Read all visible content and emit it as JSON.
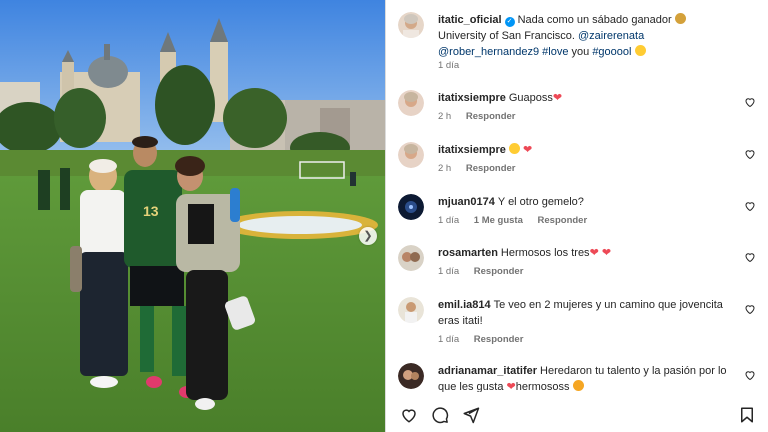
{
  "post": {
    "username": "itatic_oficial",
    "caption": {
      "part1": "Nada como un sábado ganador",
      "part2": "University of San Francisco.",
      "mention1": "@zairerenata",
      "mention2": "@rober_hernandez9",
      "hashtag1": "#love",
      "word_you": "you",
      "hashtag2": "#gooool"
    },
    "time": "1 día"
  },
  "comments": [
    {
      "username": "itatixsiempre",
      "text": "Guaposs",
      "time": "2 h",
      "reply": "Responder",
      "emojis": [
        "heart"
      ]
    },
    {
      "username": "itatixsiempre",
      "text": "",
      "time": "2 h",
      "reply": "Responder",
      "emojis": [
        "smiley",
        "heart"
      ]
    },
    {
      "username": "mjuan0174",
      "text": "Y el otro gemelo?",
      "time": "1 día",
      "likes": "1 Me gusta",
      "reply": "Responder"
    },
    {
      "username": "rosamarten",
      "text": "Hermosos los tres",
      "time": "1 día",
      "reply": "Responder",
      "emojis": [
        "heart",
        "heart"
      ]
    },
    {
      "username": "emil.ia814",
      "text": "Te veo en 2 mujeres y un camino que jovencita eras itati!",
      "time": "1 día",
      "reply": "Responder"
    },
    {
      "username": "adrianamar_itatifer",
      "text": "Heredaron tu talento y la pasión por lo que les gusta",
      "text2": "hermosos",
      "text2b": "s",
      "emojis": [
        "heart",
        "smiley"
      ]
    }
  ],
  "icons": {
    "like": "heart-outline-icon",
    "comment": "comment-icon",
    "share": "send-icon",
    "save": "bookmark-icon",
    "next": "chevron-right-icon"
  },
  "colors": {
    "link": "#00376b",
    "heart": "#ed4956",
    "verified": "#0095f6",
    "muted": "#737373"
  }
}
